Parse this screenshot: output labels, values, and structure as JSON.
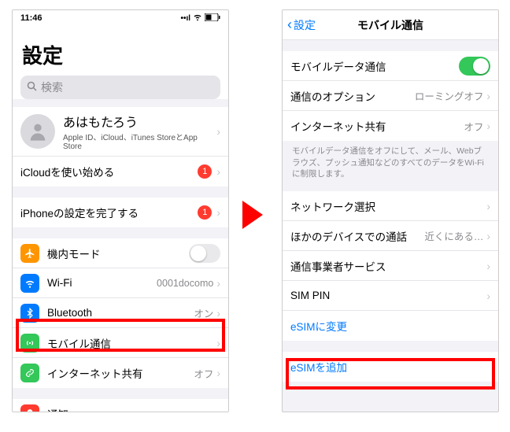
{
  "left": {
    "status_time": "11:46",
    "title": "設定",
    "search_placeholder": "検索",
    "profile": {
      "name": "あはもたろう",
      "sub": "Apple ID、iCloud、iTunes StoreとApp Store"
    },
    "icloud_row": {
      "label": "iCloudを使い始める",
      "badge": "1"
    },
    "iphone_row": {
      "label": "iPhoneの設定を完了する",
      "badge": "1"
    },
    "airplane": {
      "label": "機内モード"
    },
    "wifi": {
      "label": "Wi-Fi",
      "value": "0001docomo"
    },
    "bluetooth": {
      "label": "Bluetooth",
      "value": "オン"
    },
    "cellular": {
      "label": "モバイル通信"
    },
    "hotspot": {
      "label": "インターネット共有",
      "value": "オフ"
    },
    "notif": {
      "label": "通知"
    }
  },
  "right": {
    "back": "設定",
    "title": "モバイル通信",
    "mobile_data": {
      "label": "モバイルデータ通信"
    },
    "options": {
      "label": "通信のオプション",
      "value": "ローミングオフ"
    },
    "hotspot": {
      "label": "インターネット共有",
      "value": "オフ"
    },
    "footnote": "モバイルデータ通信をオフにして、メール、Webブラウズ、プッシュ通知などのすべてのデータをWi-Fiに制限します。",
    "network_select": {
      "label": "ネットワーク選択"
    },
    "other_device": {
      "label": "ほかのデバイスでの通話",
      "value": "近くにある…"
    },
    "carrier_services": {
      "label": "通信事業者サービス"
    },
    "sim_pin": {
      "label": "SIM PIN"
    },
    "convert_esim": {
      "label": "eSIMに変更"
    },
    "add_esim": {
      "label": "eSIMを追加"
    }
  }
}
